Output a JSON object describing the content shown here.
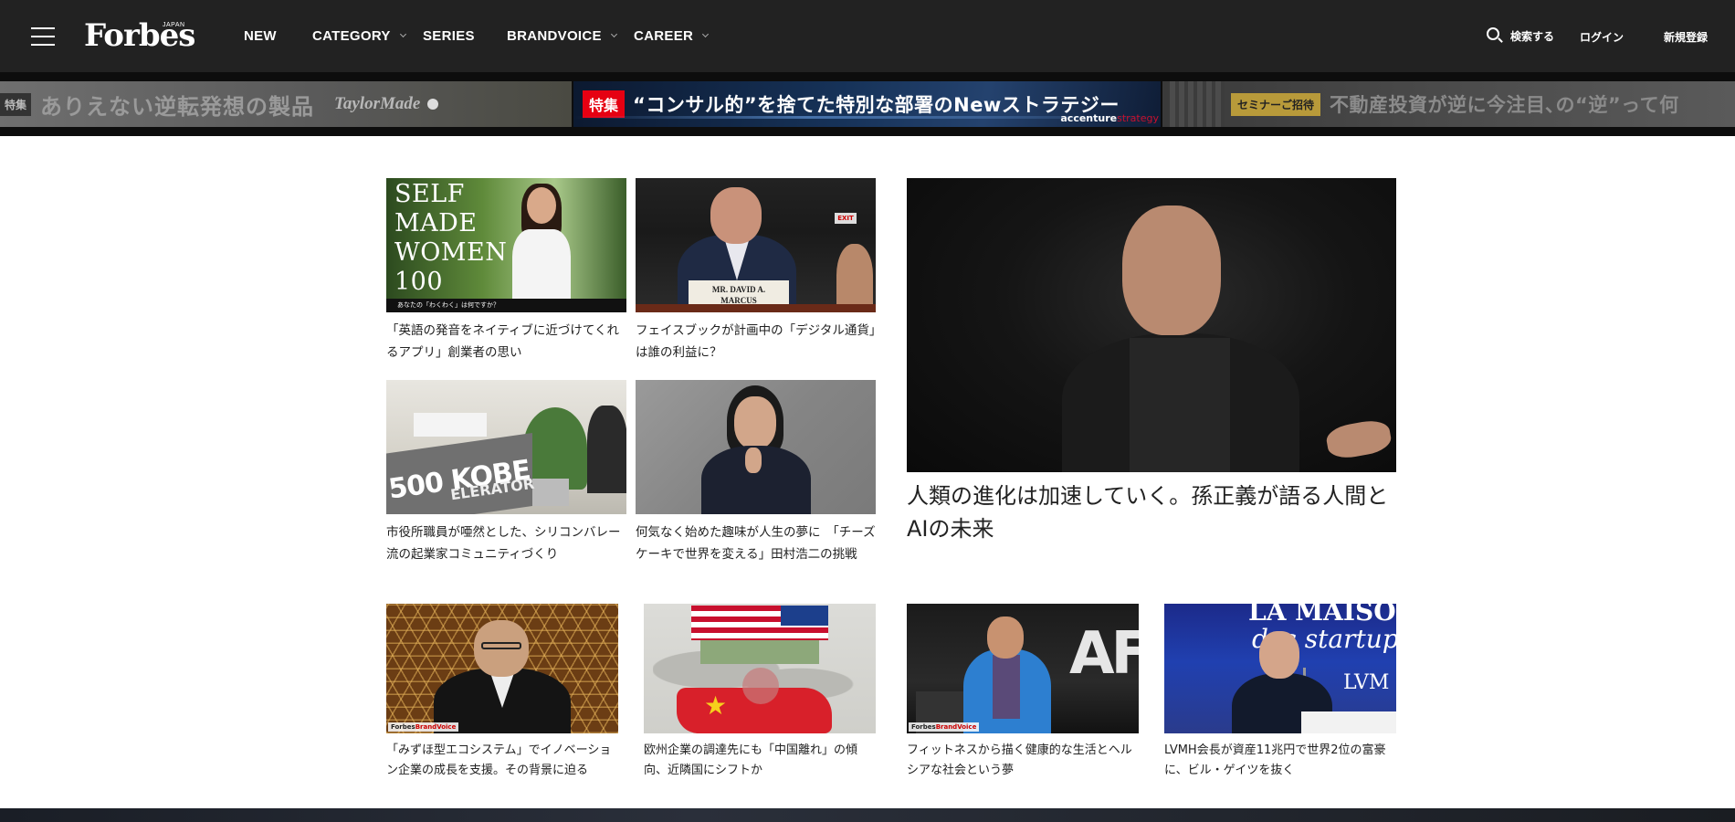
{
  "header": {
    "logo_text": "Forbes",
    "logo_sub": "JAPAN",
    "nav": [
      {
        "label": "NEW",
        "dropdown": false
      },
      {
        "label": "CATEGORY",
        "dropdown": true
      },
      {
        "label": "SERIES",
        "dropdown": false
      },
      {
        "label": "BRANDVOICE",
        "dropdown": true
      },
      {
        "label": "CAREER",
        "dropdown": true
      }
    ],
    "search_label": "検索する",
    "login_label": "ログイン",
    "register_label": "新規登録"
  },
  "promos": [
    {
      "badge": "特集",
      "text": "ありえない逆転発想の製品",
      "brand": "TaylorMade"
    },
    {
      "badge": "特集",
      "text": "“コンサル的”を捨てた特別な部署のNewストラテジー",
      "brand_main": "accenture",
      "brand_sub": "strategy"
    },
    {
      "badge": "セミナーご招待",
      "text": "不動産投資が逆に今注目､の“逆”って何"
    }
  ],
  "articles": {
    "a1": {
      "caption": "「英語の発音をネイティブに近づけてくれるアプリ」創業者の思い",
      "image_text": "SELF\nMADE\nWOMEN\n100",
      "image_strip": "あなたの「わくわく」は何ですか？"
    },
    "a2": {
      "caption": "フェイスブックが計画中の「デジタル通貨」は誰の利益に？",
      "plate_text": "MR. DAVID A.\nMARCUS",
      "exit_text": "EXIT"
    },
    "a3": {
      "caption": "市役所職員が唖然とした、シリコンバレー流の起業家コミュニティづくり",
      "sign_text": "500 KOBE",
      "sign_sub": "ELERATOR"
    },
    "a4": {
      "caption": "何気なく始めた趣味が人生の夢に　「チーズケーキで世界を変える」田村浩二の挑戦"
    },
    "feature": {
      "caption": "人類の進化は加速していく。孫正義が語る人間とAIの未来"
    },
    "b1": {
      "caption": "「みずほ型エコシステム」でイノベーション企業の成長を支援。その背景に迫る",
      "tag_a": "Forbes",
      "tag_b": "BrandVoice"
    },
    "b2": {
      "caption": "欧州企業の調達先にも「中国離れ」の傾向、近隣国にシフトか"
    },
    "b3": {
      "caption": "フィットネスから描く健康的な生活とヘルシアな社会という夢",
      "tag_a": "Forbes",
      "tag_b": "BrandVoice",
      "logo_text": "AF"
    },
    "b4": {
      "caption": "LVMH会長が資産11兆円で世界2位の富豪に、ビル・ゲイツを抜く",
      "bg_text1": "LA MAISON",
      "bg_text2": "des startups",
      "bg_text3": "LVM"
    }
  }
}
